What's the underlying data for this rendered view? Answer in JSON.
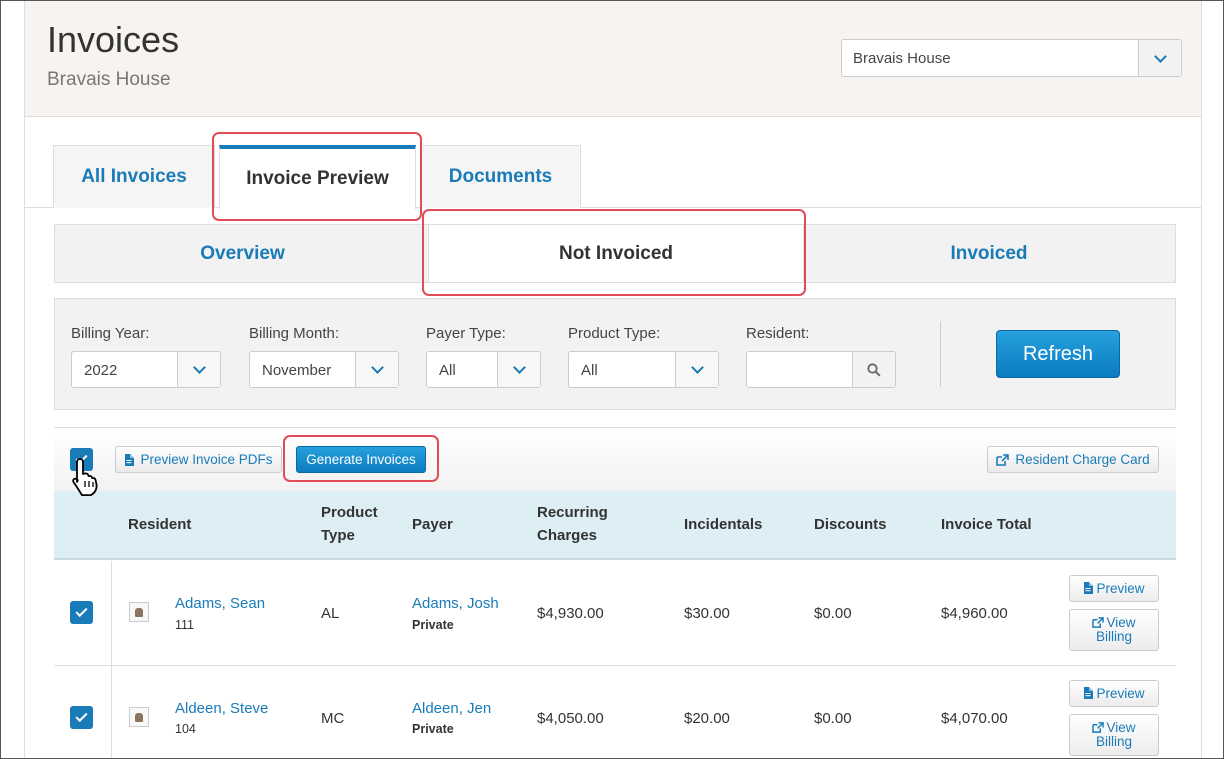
{
  "header": {
    "title": "Invoices",
    "subtitle": "Bravais House",
    "facility": "Bravais House"
  },
  "tabs": [
    {
      "label": "All Invoices"
    },
    {
      "label": "Invoice Preview"
    },
    {
      "label": "Documents"
    }
  ],
  "subtabs": [
    {
      "label": "Overview"
    },
    {
      "label": "Not Invoiced"
    },
    {
      "label": "Invoiced"
    }
  ],
  "filters": {
    "billing_year": {
      "label": "Billing Year:",
      "value": "2022"
    },
    "billing_month": {
      "label": "Billing Month:",
      "value": "November"
    },
    "payer_type": {
      "label": "Payer Type:",
      "value": "All"
    },
    "product_type": {
      "label": "Product Type:",
      "value": "All"
    },
    "resident": {
      "label": "Resident:",
      "value": ""
    },
    "refresh_label": "Refresh"
  },
  "toolbar": {
    "preview_pdfs": "Preview Invoice PDFs",
    "generate": "Generate Invoices",
    "charge_card": "Resident Charge Card"
  },
  "table": {
    "headers": {
      "resident": "Resident",
      "product_type_1": "Product",
      "product_type_2": "Type",
      "payer": "Payer",
      "recurring_1": "Recurring",
      "recurring_2": "Charges",
      "incidentals": "Incidentals",
      "discounts": "Discounts",
      "total": "Invoice Total"
    },
    "rows": [
      {
        "name": "Adams, Sean",
        "room": "111",
        "product": "AL",
        "payer": "Adams, Josh",
        "payer_type": "Private",
        "recurring": "$4,930.00",
        "incidentals": "$30.00",
        "discounts": "$0.00",
        "total": "$4,960.00",
        "preview": "Preview",
        "view_1": "View",
        "view_2": "Billing"
      },
      {
        "name": "Aldeen, Steve",
        "room": "104",
        "product": "MC",
        "payer": "Aldeen, Jen",
        "payer_type": "Private",
        "recurring": "$4,050.00",
        "incidentals": "$20.00",
        "discounts": "$0.00",
        "total": "$4,070.00",
        "preview": "Preview",
        "view_1": "View",
        "view_2": "Billing"
      }
    ]
  },
  "colors": {
    "accent": "#1a7bb9",
    "highlight": "#e14c55",
    "header_bg": "#f6f3f1",
    "table_header_bg": "#ddeef5"
  }
}
